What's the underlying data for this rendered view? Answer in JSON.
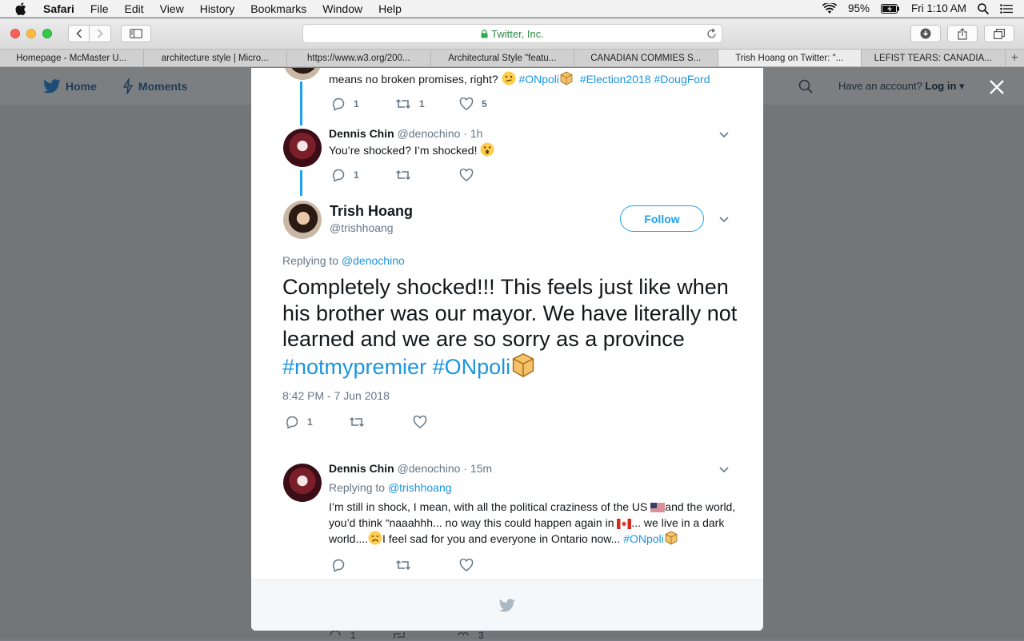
{
  "menubar": {
    "app": "Safari",
    "items": [
      "File",
      "Edit",
      "View",
      "History",
      "Bookmarks",
      "Window",
      "Help"
    ],
    "battery": "95%",
    "clock": "Fri 1:10 AM"
  },
  "toolbar": {
    "url": "Twitter, Inc."
  },
  "tabs": [
    {
      "label": "Homepage - McMaster U..."
    },
    {
      "label": "architecture style | Micro..."
    },
    {
      "label": "https://www.w3.org/200..."
    },
    {
      "label": "Architectural Style \"featu..."
    },
    {
      "label": "CANADIAN COMMIES S..."
    },
    {
      "label": "Trish Hoang on Twitter: \"..."
    },
    {
      "label": "LEFIST TEARS: CANADIA..."
    }
  ],
  "twitter_nav": {
    "home": "Home",
    "moments": "Moments",
    "have_account": "Have an account?",
    "login": "Log in"
  },
  "tweet_top": {
    "text": "means no broken promises, right?",
    "tags": [
      "#ONpoli",
      "#Election2018",
      "#DougFord"
    ],
    "replies": "1",
    "retweets": "1",
    "likes": "5"
  },
  "tweet_reply1": {
    "name": "Dennis Chin",
    "handle": "@denochino",
    "time": "· 1h",
    "text": "You’re shocked? I’m shocked!",
    "replies": "1"
  },
  "main_tweet": {
    "name": "Trish Hoang",
    "handle": "@trishhoang",
    "follow_label": "Follow",
    "replying_prefix": "Replying to",
    "replying_to": "@denochino",
    "text": "Completely shocked!!! This feels just like when his brother was our mayor. We have literally not learned and we are so sorry as a province",
    "tags": [
      "#notmypremier",
      "#ONpoli"
    ],
    "timestamp": "8:42 PM - 7 Jun 2018",
    "replies": "1"
  },
  "tweet_reply2": {
    "name": "Dennis Chin",
    "handle": "@denochino",
    "time": "· 15m",
    "replying_prefix": "Replying to",
    "replying_to": "@trishhoang",
    "text_part1": "I’m still in shock, I mean, with all the political craziness of the US",
    "text_part2": "and the world, you’d think “naaahhh... no way this could happen again in",
    "text_part3": "... we live in a dark world....",
    "text_part4": "I feel sad for you and everyone in Ontario now...",
    "tag": "#ONpoli"
  },
  "bg_tweet": {
    "replies": "1",
    "likes": "3"
  },
  "colors": {
    "twitter_blue": "#1da1f2",
    "link_blue": "#1b95e0",
    "text_gray": "#657786"
  }
}
